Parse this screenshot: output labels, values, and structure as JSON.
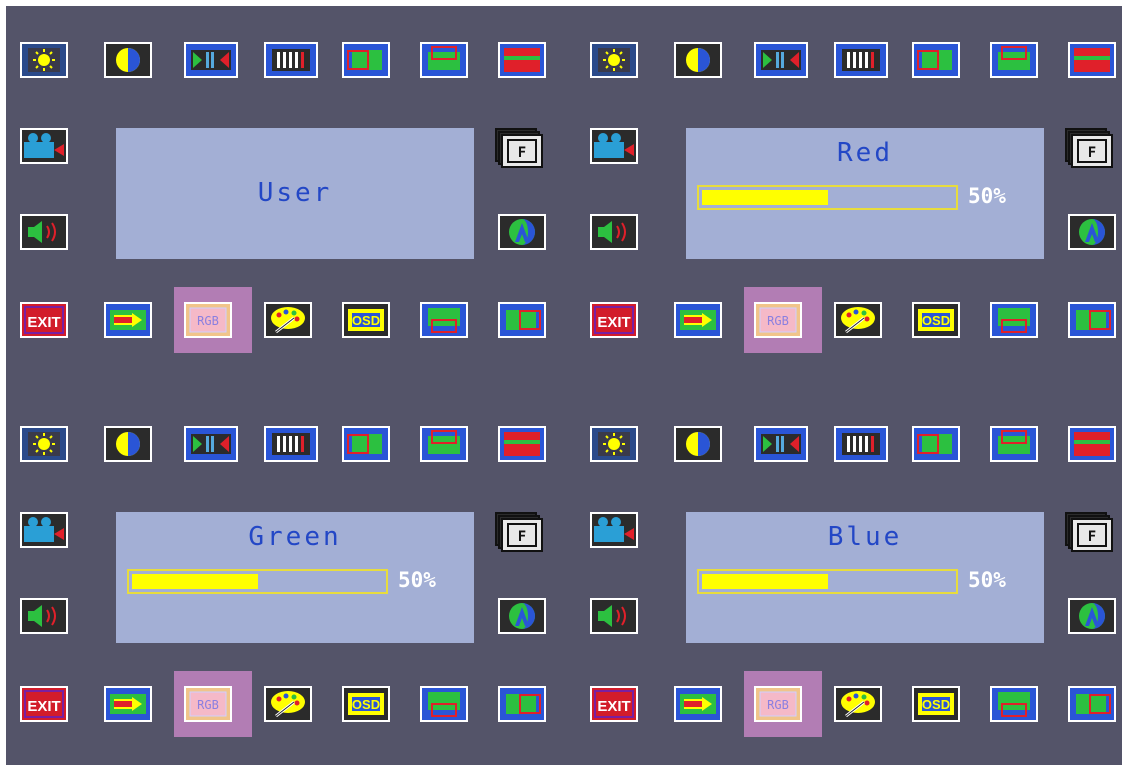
{
  "osd": {
    "selected_menu_icon": "rgb-icon",
    "colors": {
      "background": "#545469",
      "lcd_panel": "#a3afd5",
      "lcd_text": "#2347c6",
      "bar_fill": "#ffff00",
      "bar_border": "#e7dc3e",
      "selection_highlight": "#b27db4"
    },
    "panels": [
      {
        "title": "User",
        "show_bar": false
      },
      {
        "title": "Red",
        "show_bar": true,
        "level": 0.5,
        "percent_label": "50%"
      },
      {
        "title": "Green",
        "show_bar": true,
        "level": 0.5,
        "percent_label": "50%"
      },
      {
        "title": "Blue",
        "show_bar": true,
        "level": 0.5,
        "percent_label": "50%"
      }
    ],
    "icons_top_row": [
      "brightness-icon",
      "contrast-icon",
      "h-size-icon",
      "v-size-icon",
      "h-position-icon",
      "v-position-icon",
      "screen-fill-icon"
    ],
    "icons_left_column": [
      "video-icon",
      "volume-icon"
    ],
    "icons_right_column": [
      "frame-icon",
      "language-icon"
    ],
    "icons_bottom_row": [
      "exit-icon",
      "next-arrow-icon",
      "rgb-icon",
      "color-palette-icon",
      "osd-icon",
      "bottom-position-icon",
      "side-position-icon"
    ],
    "icon_text": {
      "exit": "EXIT",
      "rgb": "RGB",
      "osd": "OSD",
      "frame": "F"
    }
  }
}
